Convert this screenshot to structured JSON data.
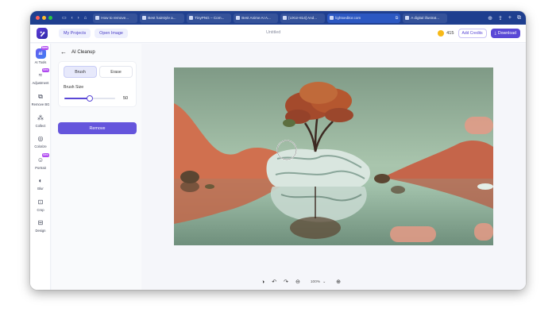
{
  "browser": {
    "tabs": [
      {
        "title": "How to remove..."
      },
      {
        "title": "Best hairstyle a..."
      },
      {
        "title": "TinyPNG – Com..."
      },
      {
        "title": "Best Anime AI A..."
      },
      {
        "title": "[UXUI-814] And..."
      },
      {
        "title": "lightxeditor.com",
        "active": true
      },
      {
        "title": "A digital illustrat..."
      }
    ]
  },
  "header": {
    "my_projects": "My Projects",
    "open_image": "Open Image",
    "doc_title": "Untitled",
    "credits": "415",
    "add_credits": "Add Credits",
    "download": "Download"
  },
  "rail": {
    "items": [
      {
        "label": "AI Tools",
        "icon": "ai-tools-icon",
        "badge": "New",
        "active": true
      },
      {
        "label": "Adjustment",
        "icon": "adjustment-icon",
        "badge": "New"
      },
      {
        "label": "Remove BG",
        "icon": "remove-bg-icon"
      },
      {
        "label": "Collect",
        "icon": "collect-icon"
      },
      {
        "label": "Colorize",
        "icon": "colorize-icon"
      },
      {
        "label": "Portrait",
        "icon": "portrait-icon",
        "badge": "New"
      },
      {
        "label": "Blur",
        "icon": "blur-icon"
      },
      {
        "label": "Crop",
        "icon": "crop-icon"
      },
      {
        "label": "Design",
        "icon": "design-icon"
      }
    ]
  },
  "panel": {
    "title": "AI Cleanup",
    "brush_tab": "Brush",
    "erase_tab": "Erase",
    "brush_size_label": "Brush Size",
    "brush_size": "50",
    "brush_size_fraction": 0.5,
    "remove": "Remove"
  },
  "canvas": {
    "zoom": "100%"
  },
  "colors": {
    "accent": "#5a48d6",
    "browser_bar": "#1f3f8f"
  }
}
